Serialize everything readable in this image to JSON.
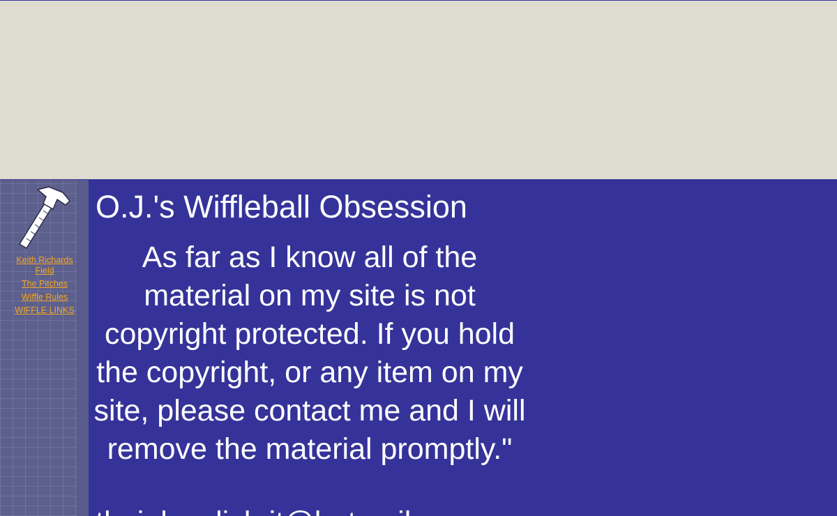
{
  "sidebar": {
    "icon": "hammer-icon",
    "nav": [
      {
        "label": "Keith Richards Field"
      },
      {
        "label": "The Pitches"
      },
      {
        "label": "Wiffle Rules"
      },
      {
        "label": "WIFFLE LINKS"
      }
    ]
  },
  "main": {
    "title": "O.J.'s Wiffleball Obsession",
    "notice": "As far as I know all of the material on my site is not copyright protected. If you hold the copyright, or any item on my site, please contact me and I will remove the material promptly.\"",
    "email": "theiglzoolich.it@hotmail.com"
  },
  "colors": {
    "background": "#353399",
    "top_band": "#dedbd0",
    "link": "#f5a623",
    "text": "#ffffff"
  }
}
